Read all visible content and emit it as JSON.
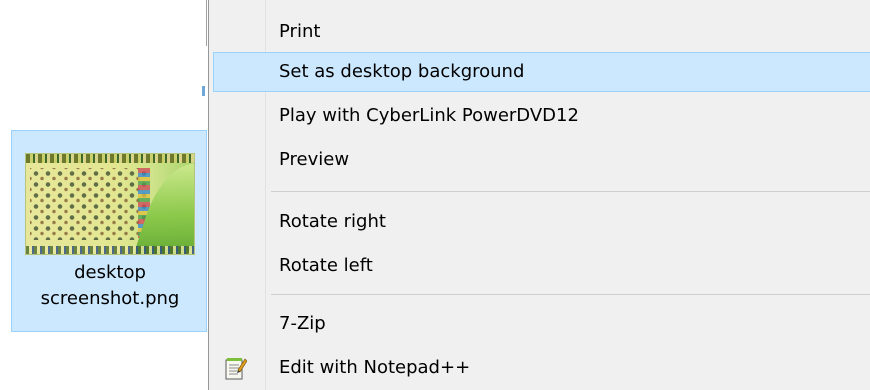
{
  "file": {
    "name_line1": "desktop",
    "name_line2": "screenshot.png"
  },
  "context_menu": {
    "items": [
      {
        "label": "Print"
      },
      {
        "label": "Set as desktop background",
        "highlighted": true
      },
      {
        "label": "Play with CyberLink PowerDVD12"
      },
      {
        "label": "Preview"
      },
      {
        "label": "Rotate right"
      },
      {
        "label": "Rotate left"
      },
      {
        "label": "7-Zip"
      },
      {
        "label": "Edit with Notepad++",
        "icon": "notepad-plus-plus-icon"
      }
    ]
  },
  "colors": {
    "selection_fill": "#cce8ff",
    "selection_border": "#99d1ff",
    "menu_background": "#f0f0f0"
  }
}
